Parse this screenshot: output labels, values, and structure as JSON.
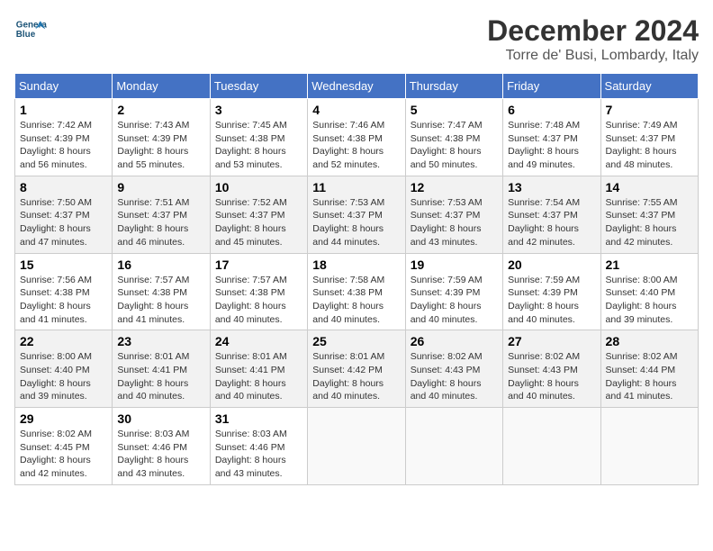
{
  "header": {
    "logo_line1": "General",
    "logo_line2": "Blue",
    "month_title": "December 2024",
    "location": "Torre de' Busi, Lombardy, Italy"
  },
  "weekdays": [
    "Sunday",
    "Monday",
    "Tuesday",
    "Wednesday",
    "Thursday",
    "Friday",
    "Saturday"
  ],
  "weeks": [
    [
      {
        "day": "1",
        "sunrise": "7:42 AM",
        "sunset": "4:39 PM",
        "daylight": "8 hours and 56 minutes."
      },
      {
        "day": "2",
        "sunrise": "7:43 AM",
        "sunset": "4:39 PM",
        "daylight": "8 hours and 55 minutes."
      },
      {
        "day": "3",
        "sunrise": "7:45 AM",
        "sunset": "4:38 PM",
        "daylight": "8 hours and 53 minutes."
      },
      {
        "day": "4",
        "sunrise": "7:46 AM",
        "sunset": "4:38 PM",
        "daylight": "8 hours and 52 minutes."
      },
      {
        "day": "5",
        "sunrise": "7:47 AM",
        "sunset": "4:38 PM",
        "daylight": "8 hours and 50 minutes."
      },
      {
        "day": "6",
        "sunrise": "7:48 AM",
        "sunset": "4:37 PM",
        "daylight": "8 hours and 49 minutes."
      },
      {
        "day": "7",
        "sunrise": "7:49 AM",
        "sunset": "4:37 PM",
        "daylight": "8 hours and 48 minutes."
      }
    ],
    [
      {
        "day": "8",
        "sunrise": "7:50 AM",
        "sunset": "4:37 PM",
        "daylight": "8 hours and 47 minutes."
      },
      {
        "day": "9",
        "sunrise": "7:51 AM",
        "sunset": "4:37 PM",
        "daylight": "8 hours and 46 minutes."
      },
      {
        "day": "10",
        "sunrise": "7:52 AM",
        "sunset": "4:37 PM",
        "daylight": "8 hours and 45 minutes."
      },
      {
        "day": "11",
        "sunrise": "7:53 AM",
        "sunset": "4:37 PM",
        "daylight": "8 hours and 44 minutes."
      },
      {
        "day": "12",
        "sunrise": "7:53 AM",
        "sunset": "4:37 PM",
        "daylight": "8 hours and 43 minutes."
      },
      {
        "day": "13",
        "sunrise": "7:54 AM",
        "sunset": "4:37 PM",
        "daylight": "8 hours and 42 minutes."
      },
      {
        "day": "14",
        "sunrise": "7:55 AM",
        "sunset": "4:37 PM",
        "daylight": "8 hours and 42 minutes."
      }
    ],
    [
      {
        "day": "15",
        "sunrise": "7:56 AM",
        "sunset": "4:38 PM",
        "daylight": "8 hours and 41 minutes."
      },
      {
        "day": "16",
        "sunrise": "7:57 AM",
        "sunset": "4:38 PM",
        "daylight": "8 hours and 41 minutes."
      },
      {
        "day": "17",
        "sunrise": "7:57 AM",
        "sunset": "4:38 PM",
        "daylight": "8 hours and 40 minutes."
      },
      {
        "day": "18",
        "sunrise": "7:58 AM",
        "sunset": "4:38 PM",
        "daylight": "8 hours and 40 minutes."
      },
      {
        "day": "19",
        "sunrise": "7:59 AM",
        "sunset": "4:39 PM",
        "daylight": "8 hours and 40 minutes."
      },
      {
        "day": "20",
        "sunrise": "7:59 AM",
        "sunset": "4:39 PM",
        "daylight": "8 hours and 40 minutes."
      },
      {
        "day": "21",
        "sunrise": "8:00 AM",
        "sunset": "4:40 PM",
        "daylight": "8 hours and 39 minutes."
      }
    ],
    [
      {
        "day": "22",
        "sunrise": "8:00 AM",
        "sunset": "4:40 PM",
        "daylight": "8 hours and 39 minutes."
      },
      {
        "day": "23",
        "sunrise": "8:01 AM",
        "sunset": "4:41 PM",
        "daylight": "8 hours and 40 minutes."
      },
      {
        "day": "24",
        "sunrise": "8:01 AM",
        "sunset": "4:41 PM",
        "daylight": "8 hours and 40 minutes."
      },
      {
        "day": "25",
        "sunrise": "8:01 AM",
        "sunset": "4:42 PM",
        "daylight": "8 hours and 40 minutes."
      },
      {
        "day": "26",
        "sunrise": "8:02 AM",
        "sunset": "4:43 PM",
        "daylight": "8 hours and 40 minutes."
      },
      {
        "day": "27",
        "sunrise": "8:02 AM",
        "sunset": "4:43 PM",
        "daylight": "8 hours and 40 minutes."
      },
      {
        "day": "28",
        "sunrise": "8:02 AM",
        "sunset": "4:44 PM",
        "daylight": "8 hours and 41 minutes."
      }
    ],
    [
      {
        "day": "29",
        "sunrise": "8:02 AM",
        "sunset": "4:45 PM",
        "daylight": "8 hours and 42 minutes."
      },
      {
        "day": "30",
        "sunrise": "8:03 AM",
        "sunset": "4:46 PM",
        "daylight": "8 hours and 43 minutes."
      },
      {
        "day": "31",
        "sunrise": "8:03 AM",
        "sunset": "4:46 PM",
        "daylight": "8 hours and 43 minutes."
      },
      null,
      null,
      null,
      null
    ]
  ]
}
